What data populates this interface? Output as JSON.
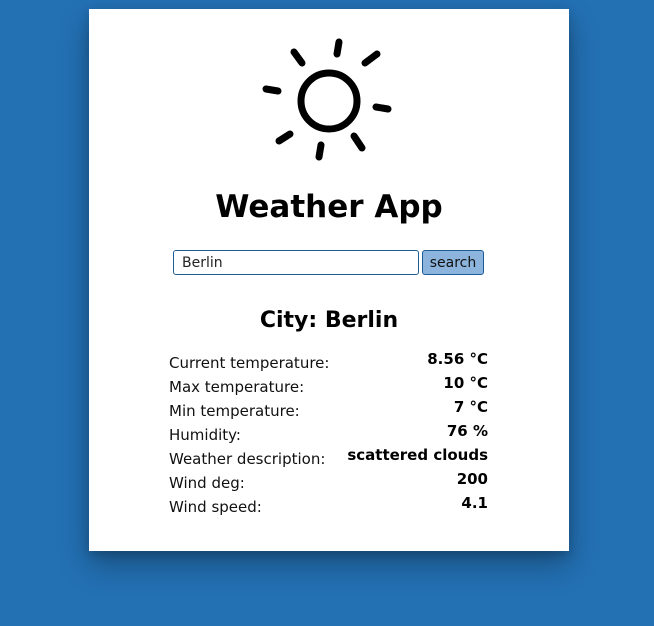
{
  "app": {
    "title": "Weather App",
    "icon": "sun-icon"
  },
  "search": {
    "value": "Berlin",
    "button_label": "search"
  },
  "result": {
    "city_heading": "City: Berlin",
    "stats": [
      {
        "label": "Current temperature:",
        "value": "8.56 °C"
      },
      {
        "label": "Max temperature:",
        "value": "10 °C"
      },
      {
        "label": "Min temperature:",
        "value": "7 °C"
      },
      {
        "label": "Humidity:",
        "value": "76 %"
      },
      {
        "label": "Weather description:",
        "value": "scattered clouds"
      },
      {
        "label": "Wind deg:",
        "value": "200"
      },
      {
        "label": "Wind speed:",
        "value": "4.1"
      }
    ]
  },
  "colors": {
    "background": "#2370b3",
    "card": "#ffffff",
    "button": "#8cb4dc",
    "border": "#1d5d97"
  }
}
